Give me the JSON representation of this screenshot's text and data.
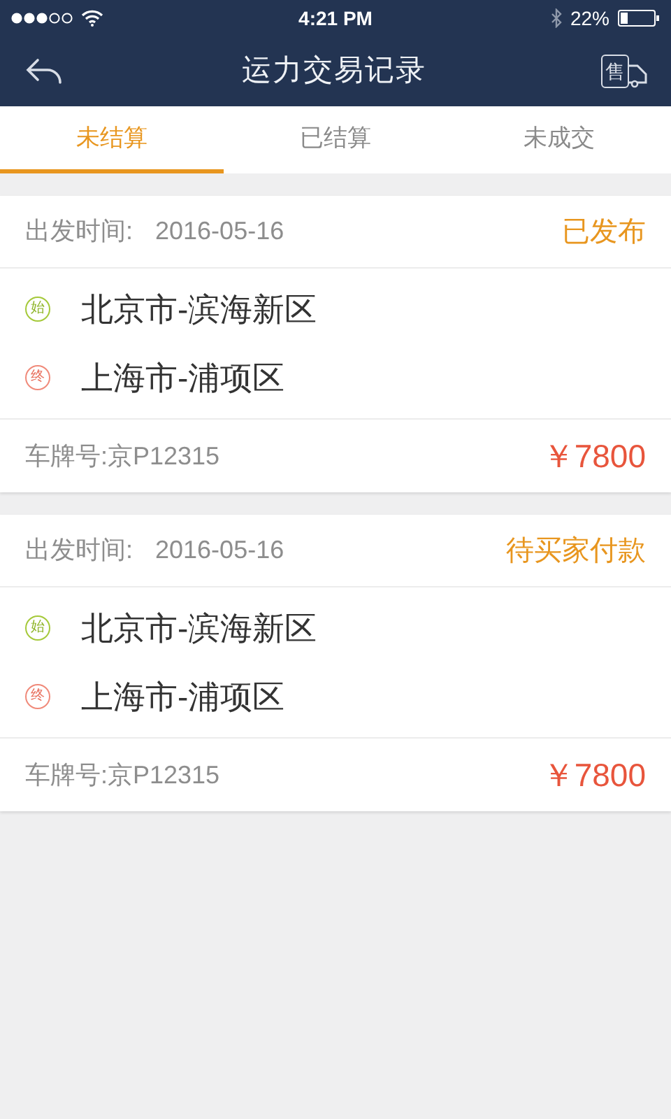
{
  "status_bar": {
    "time": "4:21 PM",
    "battery": "22%"
  },
  "nav": {
    "title": "运力交易记录",
    "action_label": "售"
  },
  "tabs": [
    {
      "label": "未结算",
      "selected": true
    },
    {
      "label": "已结算",
      "selected": false
    },
    {
      "label": "未成交",
      "selected": false
    }
  ],
  "records": [
    {
      "departure_label": "出发时间:",
      "departure_date": "2016-05-16",
      "status": "已发布",
      "origin_marker": "始",
      "origin": "北京市-滨海新区",
      "destination_marker": "终",
      "destination": "上海市-浦项区",
      "plate": "车牌号:京P12315",
      "price": "￥7800"
    },
    {
      "departure_label": "出发时间:",
      "departure_date": "2016-05-16",
      "status": "待买家付款",
      "origin_marker": "始",
      "origin": "北京市-滨海新区",
      "destination_marker": "终",
      "destination": "上海市-浦项区",
      "plate": "车牌号:京P12315",
      "price": "￥7800"
    }
  ]
}
